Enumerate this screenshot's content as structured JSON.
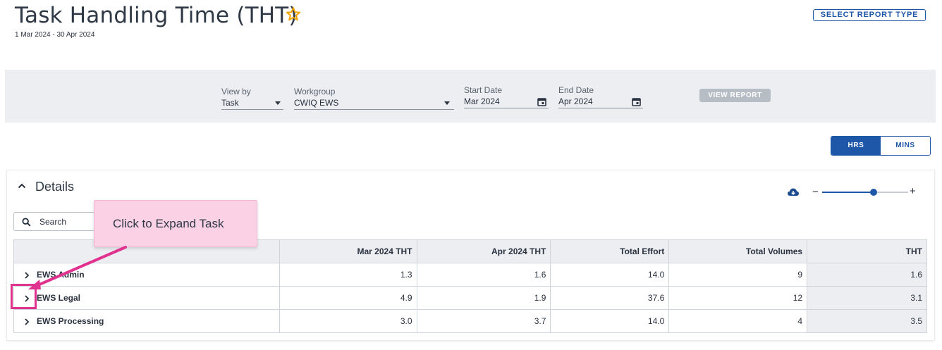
{
  "header": {
    "title": "Task Handling Time (THT)",
    "date_range": "1 Mar 2024 - 30 Apr 2024",
    "select_report_label": "SELECT REPORT TYPE"
  },
  "filters": {
    "view_by": {
      "label": "View by",
      "value": "Task"
    },
    "workgroup": {
      "label": "Workgroup",
      "value": "CWIQ EWS"
    },
    "start_date": {
      "label": "Start Date",
      "value": "Mar 2024"
    },
    "end_date": {
      "label": "End Date",
      "value": "Apr 2024"
    },
    "view_report_label": "VIEW REPORT"
  },
  "units_toggle": {
    "hrs": "HRS",
    "mins": "MINS",
    "selected": "HRS"
  },
  "details": {
    "title": "Details",
    "search_placeholder": "Search",
    "zoom_minus": "−",
    "zoom_plus": "+",
    "zoom_level": 0.6
  },
  "table": {
    "columns": [
      "",
      "Mar 2024 THT",
      "Apr 2024 THT",
      "Total Effort",
      "Total Volumes",
      "THT"
    ],
    "rows": [
      {
        "name": "EWS Admin",
        "mar": "1.3",
        "apr": "1.6",
        "effort": "14.0",
        "volumes": "9",
        "tht": "1.6"
      },
      {
        "name": "EWS Legal",
        "mar": "4.9",
        "apr": "1.9",
        "effort": "37.6",
        "volumes": "12",
        "tht": "3.1"
      },
      {
        "name": "EWS Processing",
        "mar": "3.0",
        "apr": "3.7",
        "effort": "14.0",
        "volumes": "4",
        "tht": "3.5"
      }
    ]
  },
  "callout": {
    "text": "Click to Expand Task"
  },
  "colors": {
    "accent": "#1e56a8",
    "callout_bg": "#fbd1e6",
    "callout_arrow": "#e0338f",
    "star": "#f0a500"
  }
}
